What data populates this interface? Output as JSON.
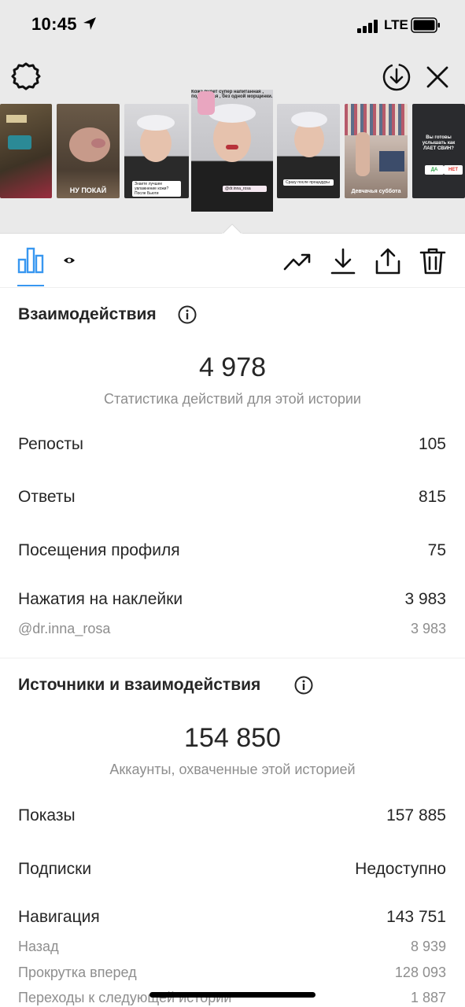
{
  "status_bar": {
    "time": "10:45",
    "network": "LTE"
  },
  "stories": [
    {
      "caption": ""
    },
    {
      "caption": "НУ ПОКАЙ"
    },
    {
      "caption": "Знаете лучшее увлажнение кожи? После Бьюти"
    },
    {
      "caption": "Кожа будет супер напитанная , подтянутая , без одной морщинки."
    },
    {
      "caption": "Сразу после процедуры"
    },
    {
      "caption": "Девчачья суббота"
    },
    {
      "caption": "Вы готовы услышать как ЛАЕТ СВИН?"
    }
  ],
  "poll": {
    "yes": "ДА",
    "no": "НЕТ"
  },
  "interactions": {
    "title": "Взаимодействия",
    "total": "4 978",
    "subtitle": "Статистика действий для этой истории",
    "rows": [
      {
        "label": "Репосты",
        "value": "105"
      },
      {
        "label": "Ответы",
        "value": "815"
      },
      {
        "label": "Посещения профиля",
        "value": "75"
      },
      {
        "label": "Нажатия на наклейки",
        "value": "3 983"
      }
    ],
    "sticker_sub": {
      "label": "@dr.inna_rosa",
      "value": "3 983"
    }
  },
  "discovery": {
    "title": "Источники и взаимодействия",
    "total": "154 850",
    "subtitle": "Аккаунты, охваченные этой историей",
    "rows": [
      {
        "label": "Показы",
        "value": "157 885"
      },
      {
        "label": "Подписки",
        "value": "Недоступно"
      },
      {
        "label": "Навигация",
        "value": "143 751"
      }
    ],
    "navigation_sub": [
      {
        "label": "Назад",
        "value": "8 939"
      },
      {
        "label": "Прокрутка вперед",
        "value": "128 093"
      },
      {
        "label": "Переходы к следующей истории",
        "value": "1 887"
      }
    ]
  },
  "icons": {
    "settings": "gear-icon",
    "save_story": "download-circle-icon",
    "close": "close-icon",
    "insights_tab": "bar-chart-icon",
    "viewers_tab": "eye-icon",
    "promote": "trending-up-icon",
    "download": "download-icon",
    "share": "share-icon",
    "delete": "trash-icon",
    "info": "info-icon"
  },
  "colors": {
    "accent": "#3897f0",
    "text": "#262626",
    "secondary": "#8e8e8e",
    "header_bg": "#eaeaea"
  }
}
